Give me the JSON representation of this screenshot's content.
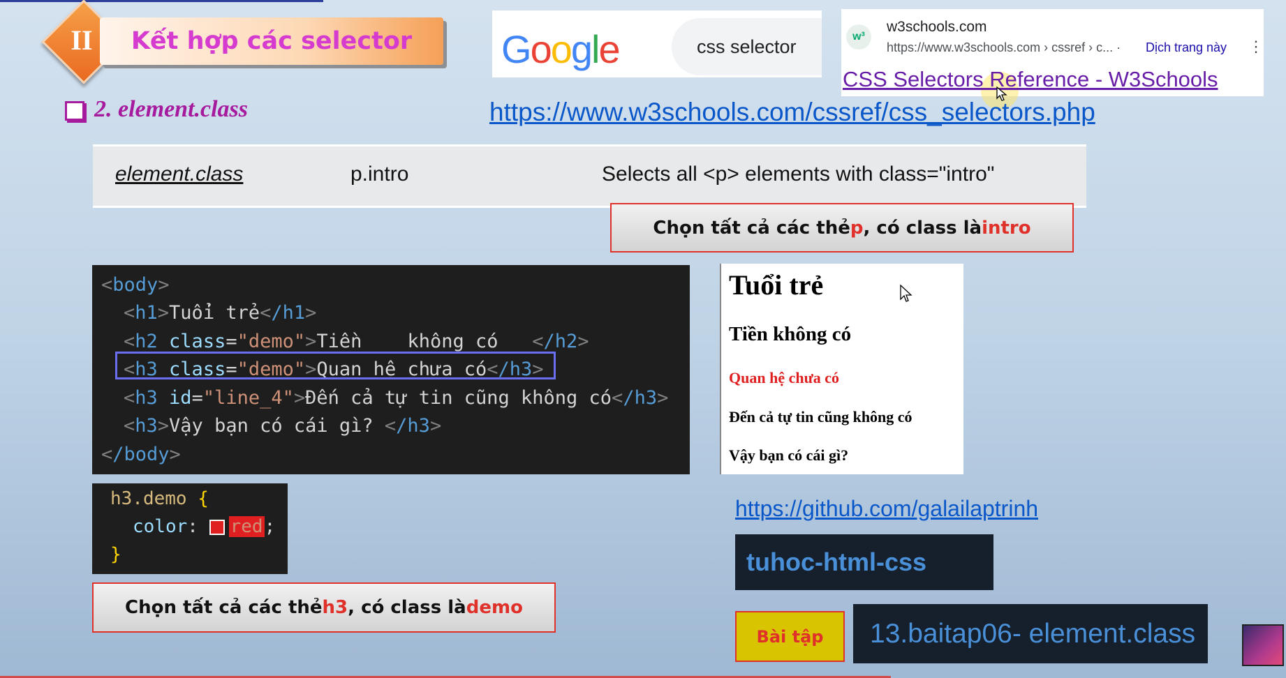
{
  "header": {
    "section_number": "II",
    "title": "Kết hợp các selector"
  },
  "google_search": {
    "logo_letters": [
      {
        "char": "G",
        "color": "#4285f4"
      },
      {
        "char": "o",
        "color": "#ea4335"
      },
      {
        "char": "o",
        "color": "#fbbc05"
      },
      {
        "char": "g",
        "color": "#4285f4"
      },
      {
        "char": "l",
        "color": "#34a853"
      },
      {
        "char": "e",
        "color": "#ea4335"
      }
    ],
    "query": "css selector",
    "result": {
      "favicon_text": "w³",
      "site": "w3schools.com",
      "url": "https://www.w3schools.com › cssref › c... ·",
      "translate": "Dịch trang này",
      "menu_icon": "⋮",
      "title": "CSS Selectors Reference - W3Schools"
    }
  },
  "section": {
    "heading": "2.  element.class",
    "reference_link": "https://www.w3schools.com/cssref/css_selectors.php"
  },
  "reference_table": {
    "selector": "element.class",
    "example": "p.intro",
    "description": "Selects all <p> elements with class=\"intro\""
  },
  "note_top": {
    "prefix": "Chọn tất cả các thẻ ",
    "tag": "p",
    "middle": ", có class là ",
    "cls": "intro"
  },
  "html_code": {
    "body_open": "body",
    "body_close": "/body",
    "lines": [
      {
        "tag": "h1",
        "attr": "",
        "value": "",
        "text": "Tuổi trẻ",
        "close": "/h1"
      },
      {
        "tag": "h2",
        "attr": "class",
        "value": "\"demo\"",
        "text": "Tiền    không có   ",
        "close": "/h2"
      },
      {
        "tag": "h3",
        "attr": "class",
        "value": "\"demo\"",
        "text": "Quan hệ chưa có",
        "close": "/h3"
      },
      {
        "tag": "h3",
        "attr": "id",
        "value": "\"line_4\"",
        "text": "Đến cả tự tin cũng không có",
        "close": "/h3"
      },
      {
        "tag": "h3",
        "attr": "",
        "value": "",
        "text": "Vậy bạn có cái gì? ",
        "close": "/h3"
      }
    ]
  },
  "css_code": {
    "selector": "h3.demo",
    "open_brace": "{",
    "property": "color",
    "value": "red",
    "close_brace": "}"
  },
  "note_bottom": {
    "prefix": "Chọn tất cả các thẻ ",
    "tag": "h3",
    "middle": ", có class là ",
    "cls": "demo"
  },
  "preview": {
    "h1": "Tuổi trẻ",
    "h2": "Tiền không có",
    "h3_demo": "Quan hệ chưa có",
    "h3_line4": "Đến cả tự tin cũng không có",
    "h3_last": "Vậy bạn có cái gì?"
  },
  "github_link": "https://github.com/galailaptrinh",
  "repo_name": "tuhoc-html-css",
  "exercise_label": "Bài tập",
  "task_name": "13.baitap06- element.class",
  "colors": {
    "accent_magenta": "#a61a9e",
    "note_red": "#e0302a",
    "link_blue": "#0a57c9"
  }
}
